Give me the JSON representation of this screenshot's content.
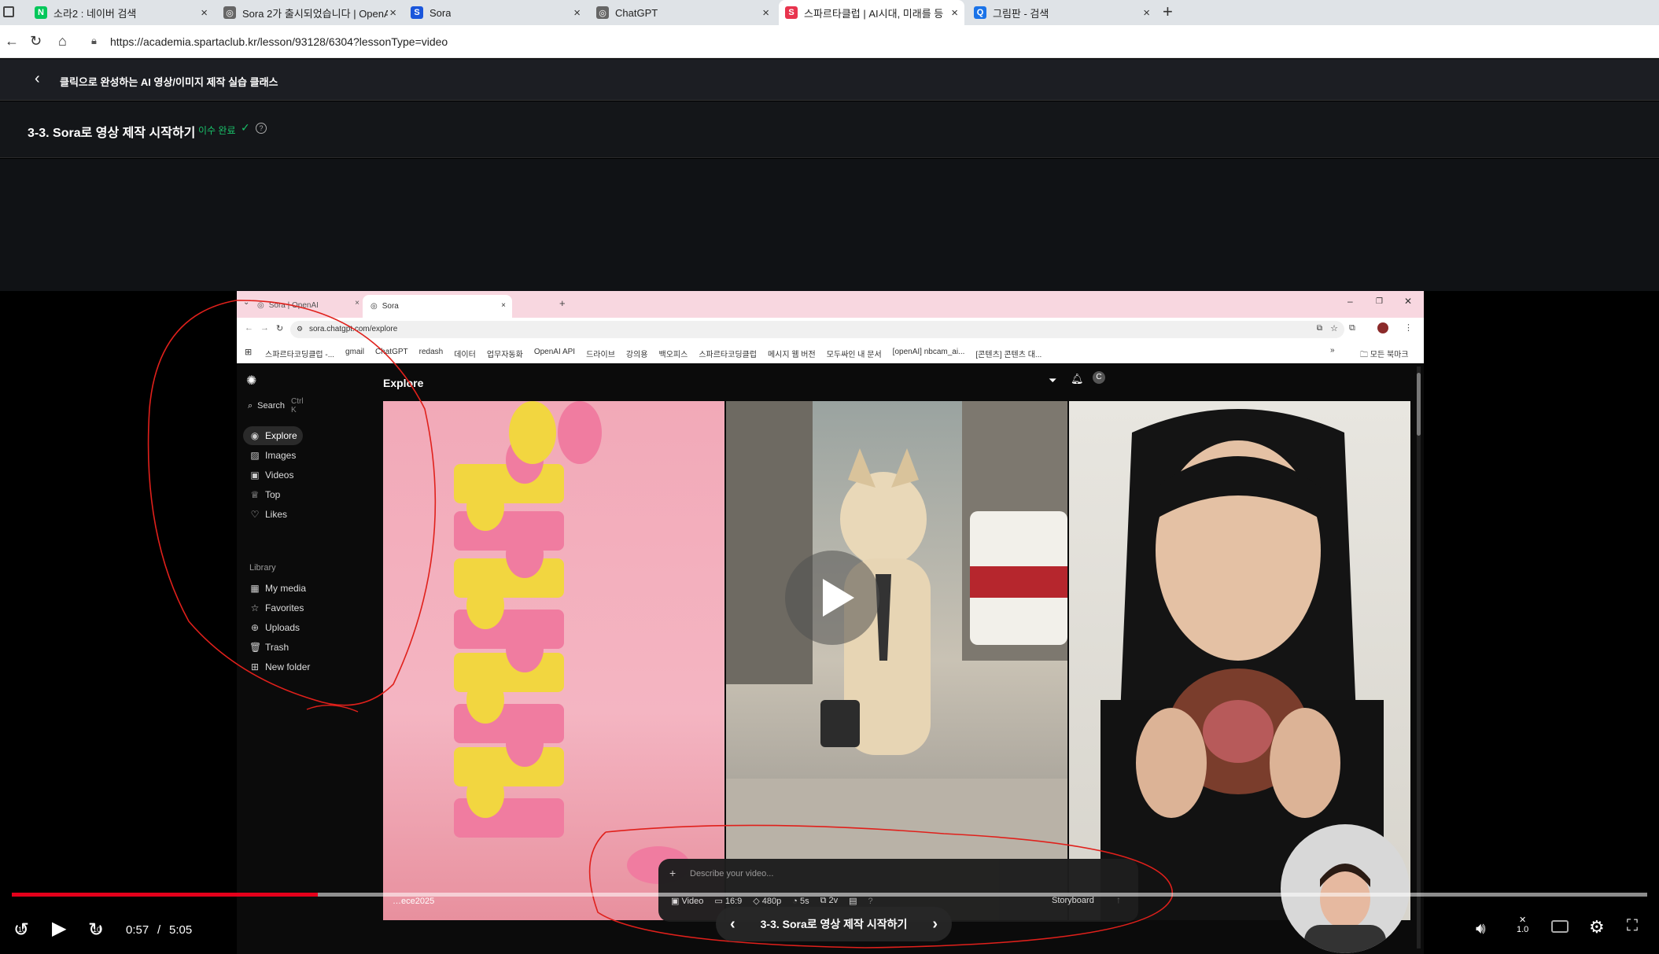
{
  "outer_tabs": [
    {
      "title": "소라2 : 네이버 검색",
      "fav_color": "#03c75a",
      "fav_text": "N"
    },
    {
      "title": "Sora 2가 출시되었습니다 | OpenAI",
      "fav_color": "#666",
      "fav_text": "◎"
    },
    {
      "title": "Sora",
      "fav_color": "#1a56db",
      "fav_text": "S"
    },
    {
      "title": "ChatGPT",
      "fav_color": "#666",
      "fav_text": "◎"
    },
    {
      "title": "스파르타클럽 | AI시대, 미래를 등",
      "fav_color": "#e8344e",
      "fav_text": "S"
    },
    {
      "title": "그림판 - 검색",
      "fav_color": "#1a73e8",
      "fav_text": "Q"
    }
  ],
  "outer_url": "https://academia.spartaclub.kr/lesson/93128/6304?lessonType=video",
  "course_title": "클릭으로 완성하는 AI 영상/이미지 제작 실습 클래스",
  "lesson_title": "3-3. Sora로 영상 제작 시작하기",
  "lesson_status": "이수 완료",
  "inner_tabs": [
    {
      "title": "Sora | OpenAI"
    },
    {
      "title": "Sora"
    }
  ],
  "inner_url": "sora.chatgpt.com/explore",
  "bookmarks": [
    "스파르타코딩클럽 -...",
    "gmail",
    "ChatGPT",
    "redash",
    "데이터",
    "업무자동화",
    "OpenAI API",
    "드라이브",
    "강의용",
    "백오피스",
    "스파르타코딩클럽",
    "메시지 웹 버전",
    "모두싸인 내 문서",
    "[openAI] nbcam_ai...",
    "[콘텐츠] 콘텐츠 대..."
  ],
  "bookmarks_more": "»",
  "all_bookmarks": "모든 북마크",
  "sora": {
    "page_title": "Explore",
    "search_label": "Search",
    "search_shortcut": "Ctrl K",
    "nav": [
      {
        "label": "Explore",
        "icon": "compass-icon"
      },
      {
        "label": "Images",
        "icon": "image-icon"
      },
      {
        "label": "Videos",
        "icon": "video-icon"
      },
      {
        "label": "Top",
        "icon": "trophy-icon"
      },
      {
        "label": "Likes",
        "icon": "heart-icon"
      }
    ],
    "library_heading": "Library",
    "library": [
      {
        "label": "My media",
        "icon": "media-icon"
      },
      {
        "label": "Favorites",
        "icon": "star-icon"
      },
      {
        "label": "Uploads",
        "icon": "upload-icon"
      },
      {
        "label": "Trash",
        "icon": "trash-icon"
      }
    ],
    "new_folder": "New folder",
    "avatar_letter": "C",
    "prompt_placeholder": "Describe your video...",
    "toolbar": {
      "type": "Video",
      "ratio": "16:9",
      "resolution": "480p",
      "duration": "5s",
      "variations": "2v",
      "storyboard": "Storyboard",
      "help": "?"
    },
    "tile_caption": "…ece2025"
  },
  "player": {
    "current_time": "0:57",
    "separator": "/",
    "duration": "5:05",
    "progress": 0.187,
    "rewind_label": "10",
    "forward_label": "10",
    "speed": "1.0",
    "caption_title": "3-3. Sora로 영상 제작 시작하기"
  },
  "colors": {
    "accent": "#e4001b",
    "complete": "#19c26a"
  }
}
